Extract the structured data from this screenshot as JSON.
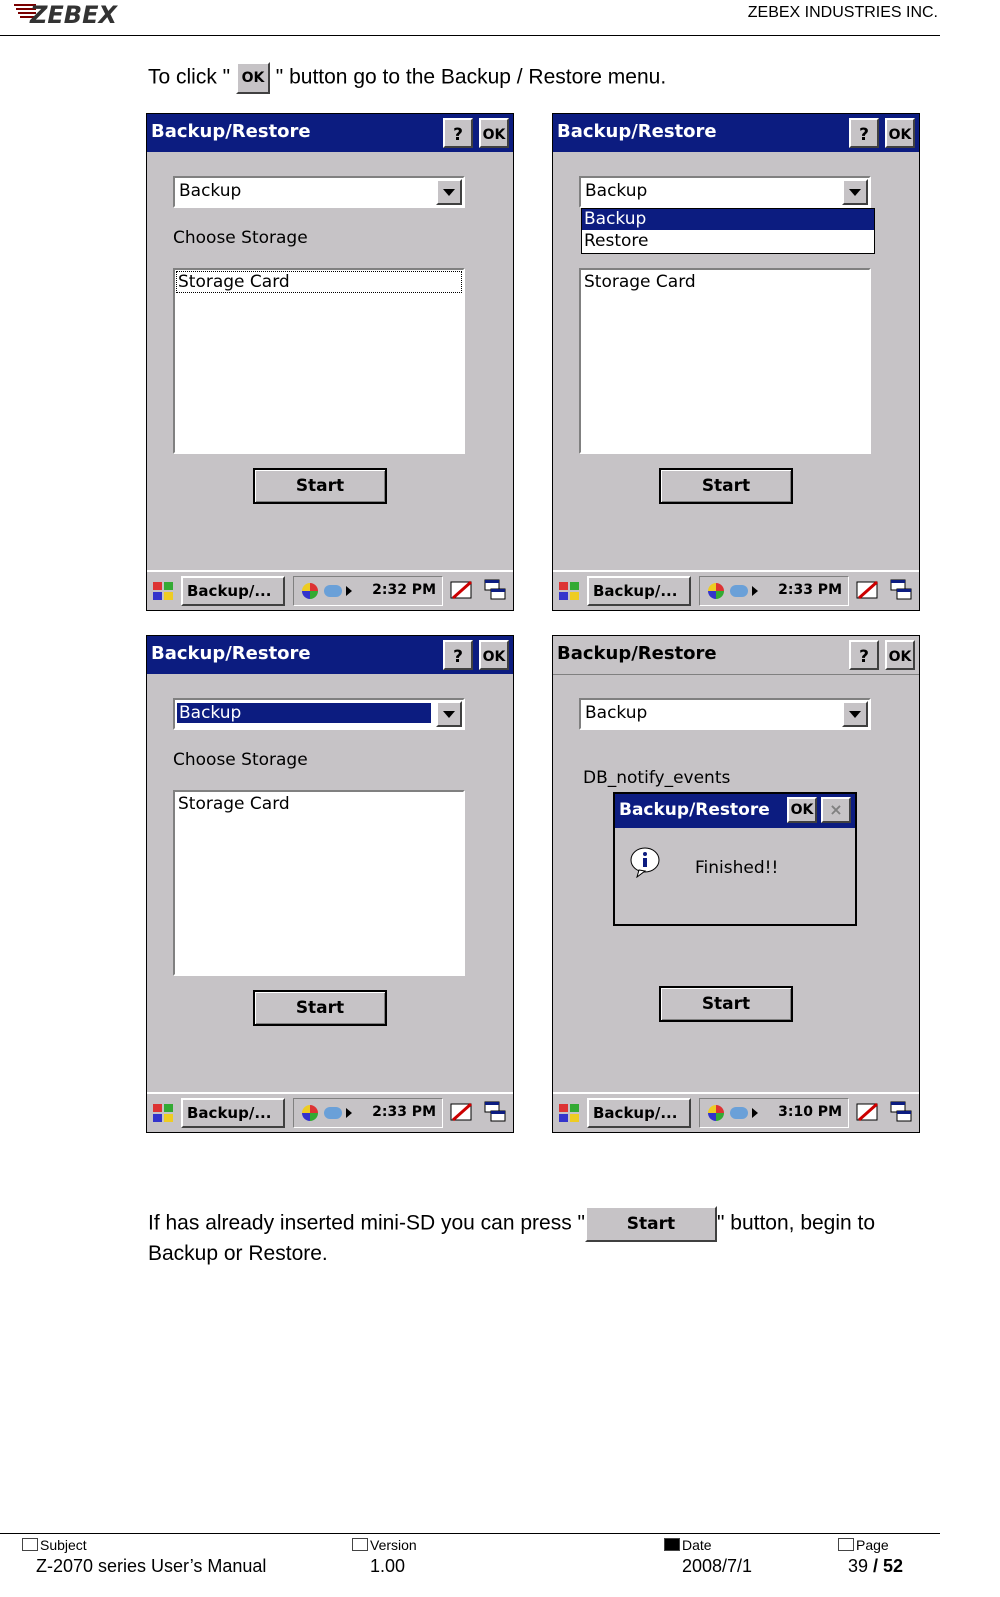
{
  "header": {
    "logo_text": "ZEBEX",
    "company": "ZEBEX INDUSTRIES INC."
  },
  "intro": {
    "prefix": "To click \" ",
    "ok_label": "OK",
    "suffix": " \" button go to the Backup / Restore menu."
  },
  "screens": [
    {
      "title": "Backup/Restore",
      "help_label": "?",
      "ok_label": "OK",
      "mode": "Backup",
      "label": "Choose Storage",
      "storage_item": "Storage Card",
      "start_label": "Start",
      "taskbar_app": "Backup/...",
      "time": "2:32 PM"
    },
    {
      "title": "Backup/Restore",
      "help_label": "?",
      "ok_label": "OK",
      "mode": "Backup",
      "options": [
        "Backup",
        "Restore"
      ],
      "storage_item": "Storage Card",
      "start_label": "Start",
      "taskbar_app": "Backup/...",
      "time": "2:33 PM"
    },
    {
      "title": "Backup/Restore",
      "help_label": "?",
      "ok_label": "OK",
      "mode": "Backup",
      "label": "Choose Storage",
      "storage_item": "Storage Card",
      "start_label": "Start",
      "taskbar_app": "Backup/...",
      "time": "2:33 PM"
    },
    {
      "title": "Backup/Restore",
      "help_label": "?",
      "ok_label": "OK",
      "mode": "Backup",
      "status": "DB_notify_events",
      "dialog": {
        "title": "Backup/Restore",
        "ok_label": "OK",
        "close_label": "×",
        "message": "Finished!!"
      },
      "start_label": "Start",
      "taskbar_app": "Backup/...",
      "time": "3:10 PM"
    }
  ],
  "outro": {
    "prefix": "If has already inserted mini-SD you can press \"",
    "start_label": "Start",
    "suffix": "\" button, begin to",
    "line2": "Backup or Restore."
  },
  "footer": {
    "subject_label": "Subject",
    "subject": "Z-2070 series User’s Manual",
    "version_label": "Version",
    "version": "1.00",
    "date_label": "Date",
    "date": "2008/7/1",
    "page_label": "Page",
    "page": "39",
    "page_sep": " / ",
    "total": "52"
  },
  "colors": {
    "titlebar": "#0c1c80",
    "window": "#c6c3c6",
    "selection": "#0c1c80"
  }
}
